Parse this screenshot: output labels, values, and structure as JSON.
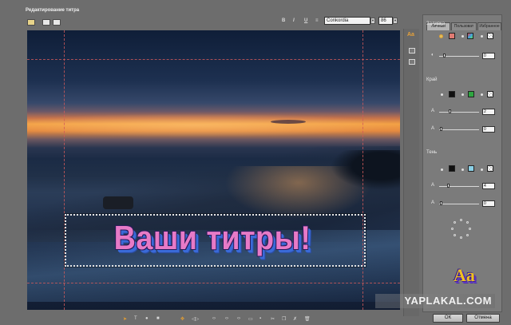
{
  "window": {
    "title": "Редактирование титра"
  },
  "toolbar": {
    "bold_label": "B",
    "italic_label": "I",
    "underline_label": "U",
    "strike_label": "≡",
    "font_name": "Conkordia",
    "font_size": "86"
  },
  "canvas": {
    "title_text": "Ваши титры!"
  },
  "side_tools": {
    "text_style_label": "Aa"
  },
  "panel": {
    "tabs": [
      "Личный",
      "Пользоват",
      "Избранное"
    ],
    "fill": {
      "label": "Заливка",
      "opacity_value": "0",
      "color": "#e07a72"
    },
    "edge": {
      "label": "Край",
      "size_value": "2",
      "softness_value": "0",
      "color": "#101010",
      "color2": "#2ea640"
    },
    "shadow": {
      "label": "Тень",
      "distance_value": "4",
      "softness_value": "0",
      "color": "#101010",
      "color2": "#8ad0e6"
    },
    "preview_label": "Aa"
  },
  "watermark": "YAPLAKAL.COM",
  "footer": {
    "ok_label": "ОК",
    "cancel_label": "Отмена"
  }
}
